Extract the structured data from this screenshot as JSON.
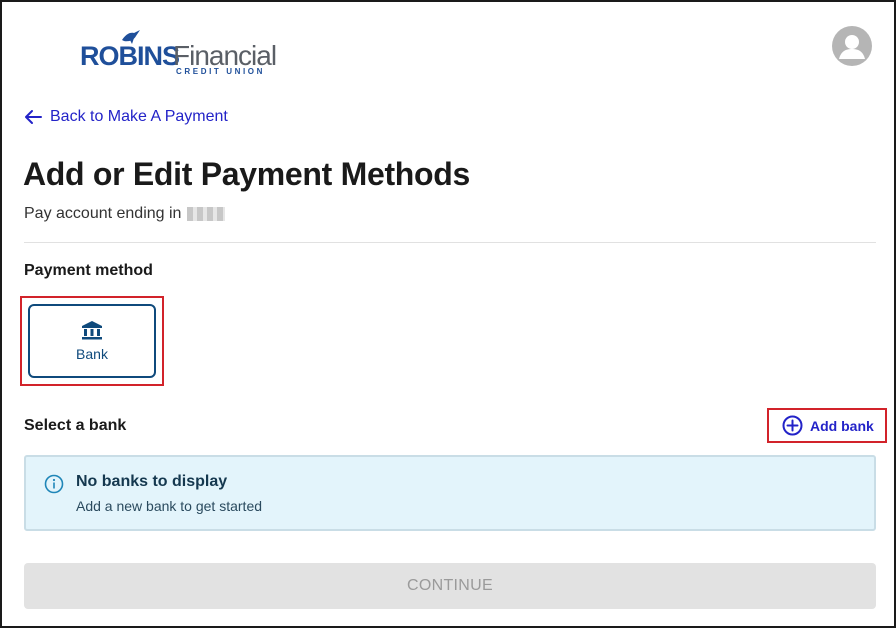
{
  "brand": {
    "name_part1": "ROBINS",
    "name_part2": "Financial",
    "tagline": "CREDIT UNION",
    "primary_color": "#1f4f9a",
    "secondary_color": "#5a5f66"
  },
  "header": {
    "avatar_icon": "user-avatar-icon"
  },
  "nav": {
    "back_label": "Back to Make A Payment",
    "back_icon": "arrow-left-icon"
  },
  "page": {
    "title": "Add or Edit Payment Methods",
    "subtitle": "Pay account ending in"
  },
  "payment_method": {
    "label": "Payment method",
    "options": [
      {
        "label": "Bank",
        "icon": "bank-icon",
        "selected": true
      }
    ]
  },
  "bank_section": {
    "label": "Select a bank",
    "add_label": "Add bank",
    "add_icon": "plus-circle-icon",
    "empty_title": "No banks to display",
    "empty_desc": "Add a new bank to get started",
    "empty_icon": "info-icon"
  },
  "actions": {
    "continue_label": "CONTINUE",
    "continue_disabled": true
  },
  "colors": {
    "link": "#2323c8",
    "accent": "#0f4a7c",
    "highlight": "#d2232a",
    "info_bg": "#e3f4fb"
  }
}
